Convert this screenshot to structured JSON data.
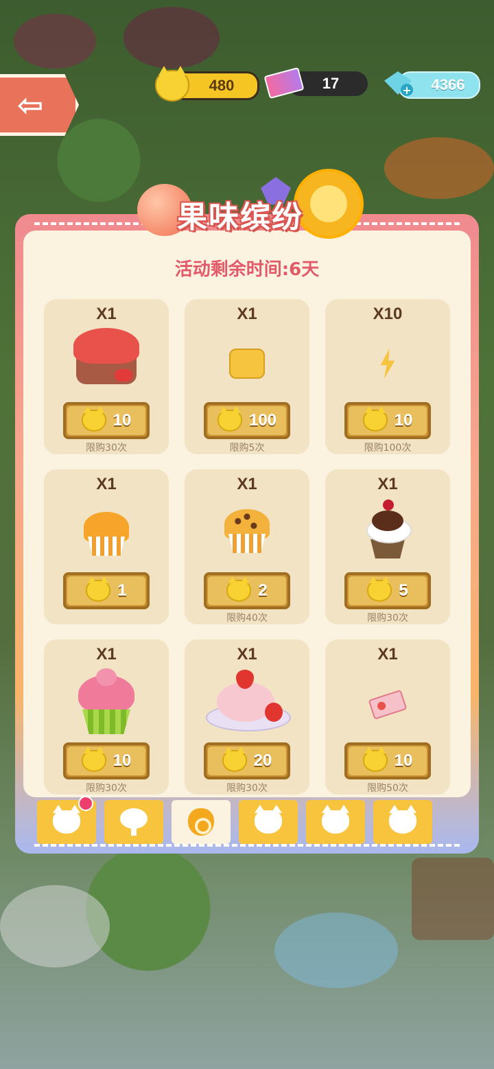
{
  "hud": {
    "coins": "480",
    "tickets": "17",
    "gems": "4366"
  },
  "event": {
    "title": "果味缤纷",
    "timer": "活动剩余时间:6天"
  },
  "shop": {
    "items": [
      {
        "qty": "X1",
        "price": "10",
        "limit": "限购30次",
        "icon": "strawberry-cake"
      },
      {
        "qty": "X1",
        "price": "100",
        "limit": "限购5次",
        "icon": "butter-block"
      },
      {
        "qty": "X10",
        "price": "10",
        "limit": "限购100次",
        "icon": "lightning-bolt"
      },
      {
        "qty": "X1",
        "price": "1",
        "limit": "",
        "icon": "orange-muffin"
      },
      {
        "qty": "X1",
        "price": "2",
        "limit": "限购40次",
        "icon": "chocolate-chip-muffin"
      },
      {
        "qty": "X1",
        "price": "5",
        "limit": "限购30次",
        "icon": "cherry-sundae"
      },
      {
        "qty": "X1",
        "price": "10",
        "limit": "限购30次",
        "icon": "pink-cupcake"
      },
      {
        "qty": "X1",
        "price": "20",
        "limit": "限购30次",
        "icon": "strawberry-ice-cream-plate"
      },
      {
        "qty": "X1",
        "price": "10",
        "limit": "限购50次",
        "icon": "ticket"
      }
    ]
  },
  "tabs": [
    {
      "icon": "cats-icon",
      "badge": true
    },
    {
      "icon": "tree-icon"
    },
    {
      "icon": "bag-icon",
      "active": true
    },
    {
      "icon": "cat-head-icon"
    },
    {
      "icon": "cat-head-icon"
    },
    {
      "icon": "cat-head-icon"
    }
  ],
  "colors": {
    "panel_pink": "#f08a8f",
    "panel_orange": "#f8b56a",
    "card_bg": "#f2e3c4",
    "price_button": "#e9bf5e",
    "timer_text": "#e25a6a",
    "tab_yellow": "#f8c43e"
  }
}
